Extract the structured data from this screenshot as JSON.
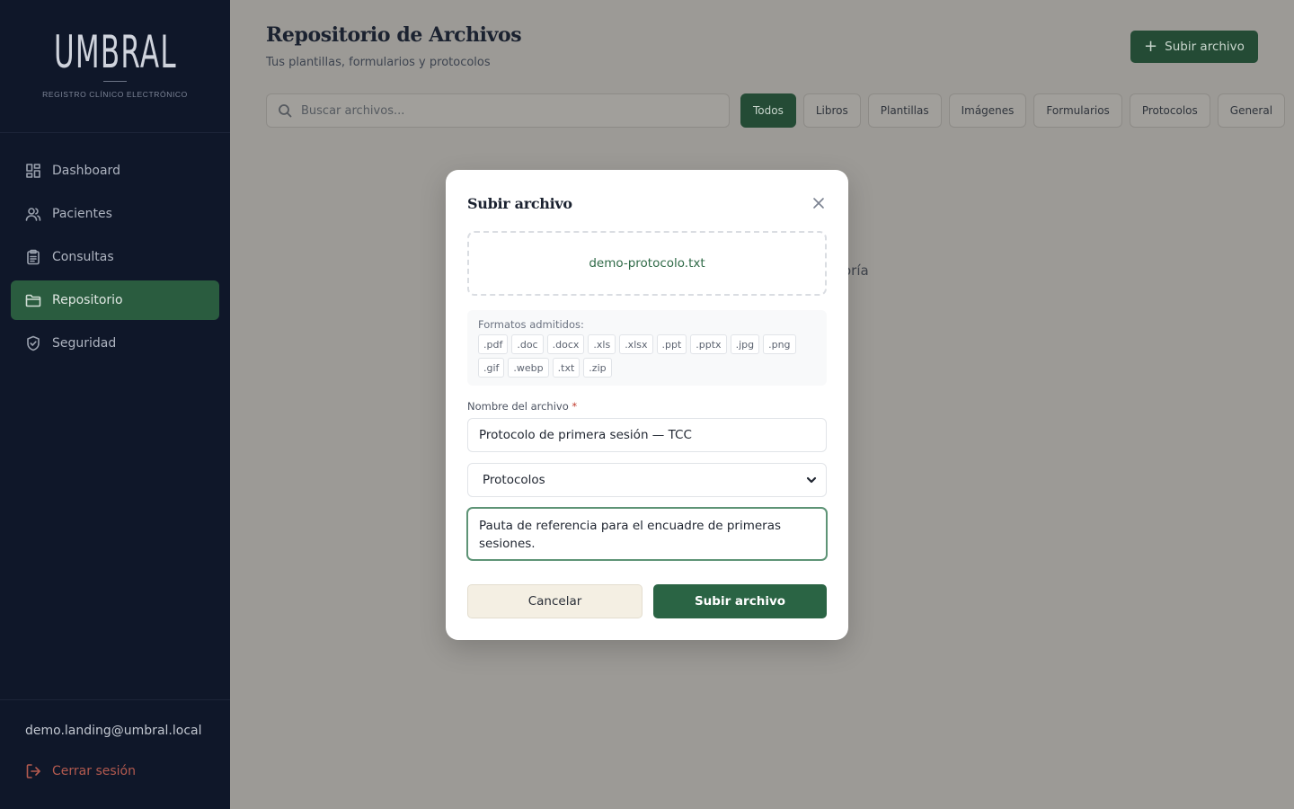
{
  "brand": {
    "name": "UMBRAL",
    "tagline": "REGISTRO CLÍNICO ELECTRÓNICO"
  },
  "sidebar": {
    "items": [
      {
        "label": "Dashboard",
        "icon": "dashboard-icon"
      },
      {
        "label": "Pacientes",
        "icon": "users-icon"
      },
      {
        "label": "Consultas",
        "icon": "clipboard-icon"
      },
      {
        "label": "Repositorio",
        "icon": "folder-icon",
        "active": true
      },
      {
        "label": "Seguridad",
        "icon": "shield-icon"
      }
    ],
    "user_email": "demo.landing@umbral.local",
    "logout_label": "Cerrar sesión"
  },
  "header": {
    "title": "Repositorio de Archivos",
    "subtitle": "Tus plantillas, formularios y protocolos",
    "upload_label": "Subir archivo"
  },
  "search": {
    "placeholder": "Buscar archivos..."
  },
  "filters": [
    "Todos",
    "Libros",
    "Plantillas",
    "Imágenes",
    "Formularios",
    "Protocolos",
    "General"
  ],
  "background_text": "oría",
  "modal": {
    "title": "Subir archivo",
    "file_name": "demo-protocolo.txt",
    "formats_label": "Formatos admitidos:",
    "formats": [
      ".pdf",
      ".doc",
      ".docx",
      ".xls",
      ".xlsx",
      ".ppt",
      ".pptx",
      ".jpg",
      ".png",
      ".gif",
      ".webp",
      ".txt",
      ".zip"
    ],
    "name_label": "Nombre del archivo",
    "required_mark": "*",
    "name_value": "Protocolo de primera sesión — TCC",
    "category_value": "Protocolos",
    "description_value": "Pauta de referencia para el encuadre de primeras sesiones.",
    "cancel_label": "Cancelar",
    "submit_label": "Subir archivo"
  },
  "colors": {
    "sidebar_bg": "#0f1729",
    "accent": "#2a5c3f",
    "danger": "#b35a4f"
  }
}
